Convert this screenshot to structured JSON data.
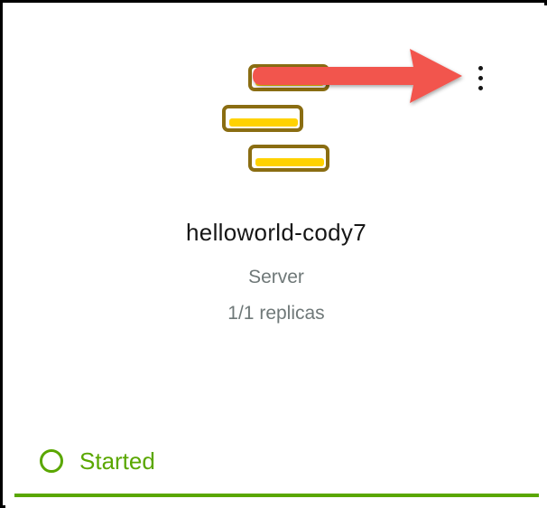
{
  "card": {
    "name": "helloworld-cody7",
    "type": "Server",
    "replicas": "1/1 replicas",
    "status": {
      "label": "Started",
      "color": "#5aa700"
    }
  },
  "icons": {
    "service": "server-stack-icon",
    "menu": "overflow-menu-icon",
    "annotation": "red-arrow-annotation"
  },
  "colors": {
    "icon_fill": "#ffd200",
    "icon_stroke": "#8a6d12",
    "arrow": "#f2544e",
    "muted_text": "#6f7878"
  }
}
